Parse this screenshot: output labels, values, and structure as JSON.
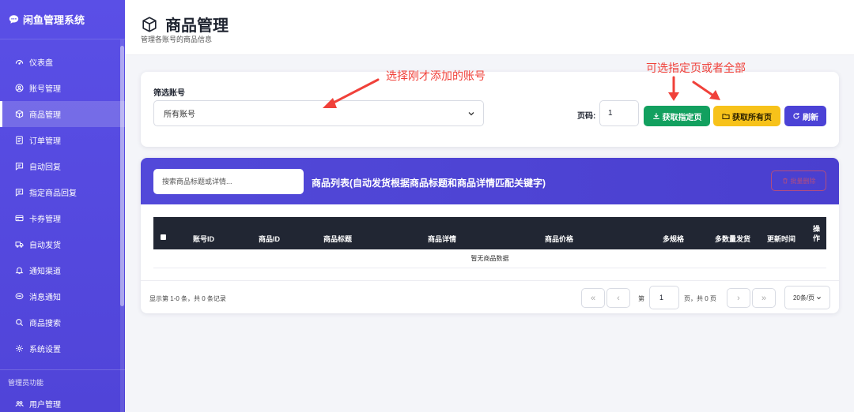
{
  "sidebar": {
    "brand": "闲鱼管理系统",
    "items": [
      {
        "label": "仪表盘",
        "icon": "dashboard-icon"
      },
      {
        "label": "账号管理",
        "icon": "user-circle-icon"
      },
      {
        "label": "商品管理",
        "icon": "box-icon",
        "active": true
      },
      {
        "label": "订单管理",
        "icon": "receipt-icon"
      },
      {
        "label": "自动回复",
        "icon": "chat-icon"
      },
      {
        "label": "指定商品回复",
        "icon": "chat-icon"
      },
      {
        "label": "卡券管理",
        "icon": "card-icon"
      },
      {
        "label": "自动发货",
        "icon": "truck-icon"
      },
      {
        "label": "通知渠道",
        "icon": "bell-icon"
      },
      {
        "label": "消息通知",
        "icon": "message-icon"
      },
      {
        "label": "商品搜索",
        "icon": "search-icon"
      },
      {
        "label": "系统设置",
        "icon": "gear-icon"
      }
    ],
    "admin_section": "管理员功能",
    "admin_items": [
      {
        "label": "用户管理",
        "icon": "users-icon"
      }
    ]
  },
  "header": {
    "title": "商品管理",
    "subtitle": "管理各账号的商品信息"
  },
  "filter": {
    "label": "筛选账号",
    "account_value": "所有账号",
    "page_label": "页码:",
    "page_value": "1",
    "btn_fetch_page": "获取指定页",
    "btn_fetch_all": "获取所有页",
    "btn_refresh": "刷新"
  },
  "annotations": {
    "select_account": "选择刚才添加的账号",
    "page_or_all": "可选指定页或者全部"
  },
  "list": {
    "search_placeholder": "搜索商品标题或详情...",
    "title": "商品列表(自动发货根据商品标题和商品详情匹配关键字)",
    "bulk_delete": "批量删除",
    "columns": [
      "账号ID",
      "商品ID",
      "商品标题",
      "商品详情",
      "商品价格",
      "多规格",
      "多数量发货",
      "更新时间",
      "操作"
    ],
    "empty_text": "暂无商品数据"
  },
  "pagination": {
    "info": "显示第 1-0 条，共 0 条记录",
    "first": "«",
    "prev": "‹",
    "page_prefix": "第",
    "page_value": "1",
    "page_suffix": "页，共 0 页",
    "next": "›",
    "last": "»",
    "page_size": "20条/页"
  },
  "colors": {
    "sidebar": "#5a4fe6",
    "accent": "#4b42d6",
    "green": "#12a05f",
    "yellow": "#f7c21a",
    "annotation": "#f0413a",
    "table_head": "#212633"
  }
}
